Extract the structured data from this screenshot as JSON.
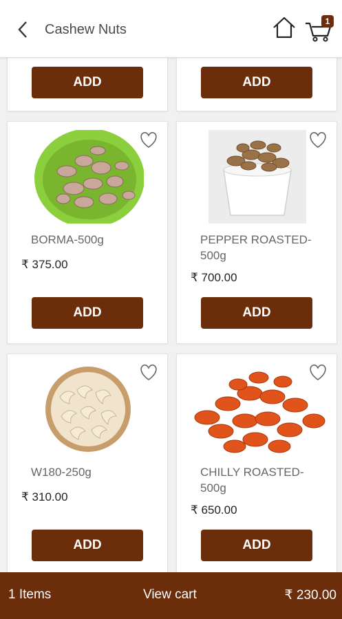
{
  "header": {
    "title": "Cashew Nuts",
    "cart_count": "1"
  },
  "buttons": {
    "add_label": "ADD"
  },
  "products": [
    {
      "name": "BORMA-500g",
      "price": "₹ 375.00"
    },
    {
      "name": "PEPPER ROASTED-500g",
      "price": "₹ 700.00"
    },
    {
      "name": "W180-250g",
      "price": "₹ 310.00"
    },
    {
      "name": "CHILLY ROASTED-500g",
      "price": "₹ 650.00"
    }
  ],
  "cart_bar": {
    "items": "1 Items",
    "view_cart": "View cart",
    "total": "₹ 230.00"
  },
  "icons": {
    "back": "chevron-left-icon",
    "home": "home-icon",
    "cart": "cart-icon",
    "wishlist": "heart-outline-icon"
  },
  "colors": {
    "brand": "#6b2d0a",
    "background": "#f1f1f1"
  }
}
